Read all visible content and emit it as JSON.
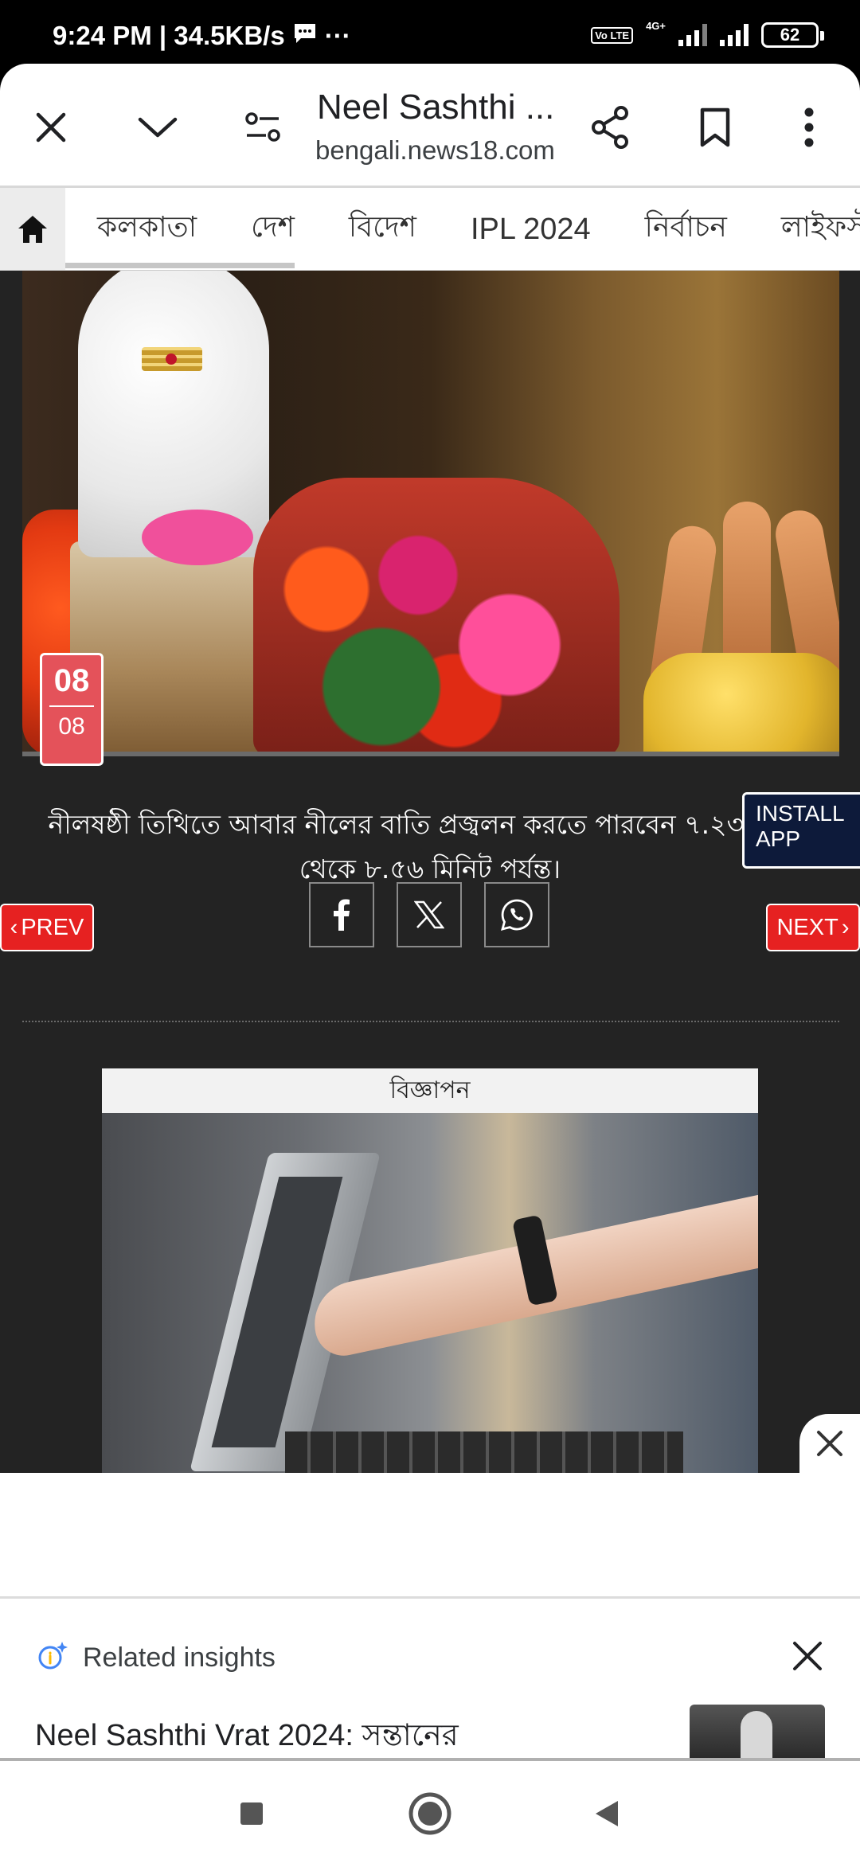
{
  "status_bar": {
    "time_speed": "9:24 PM | 34.5KB/s",
    "more": "···",
    "volte": "Vo LTE",
    "network": "4G+",
    "battery": "62"
  },
  "browser": {
    "page_title": "Neel Sashthi ...",
    "url": "bengali.news18.com"
  },
  "nav": {
    "items": [
      "কলকাতা",
      "দেশ",
      "বিদেশ",
      "IPL 2024",
      "নির্বাচন",
      "লাইফস্টাইল"
    ]
  },
  "article": {
    "date_day": "08",
    "date_month": "08",
    "caption": "নীলষষ্ঠী তিথিতে আবার নীলের বাতি প্রজ্বলন করতে পারবেন ৭.২৩ মিনিট থেকে ৮.৫৬ মিনিট পর্যন্ত।",
    "install_app": "INSTALL APP",
    "prev": "PREV",
    "next": "NEXT"
  },
  "ad": {
    "label": "বিজ্ঞাপন"
  },
  "insights": {
    "title": "Related insights",
    "headline": "Neel Sashthi Vrat 2024: সন্তানের"
  },
  "colors": {
    "accent_red": "#e62121",
    "badge_red": "#e4525a",
    "install_navy": "#0d1a3a",
    "article_bg": "#232323"
  }
}
